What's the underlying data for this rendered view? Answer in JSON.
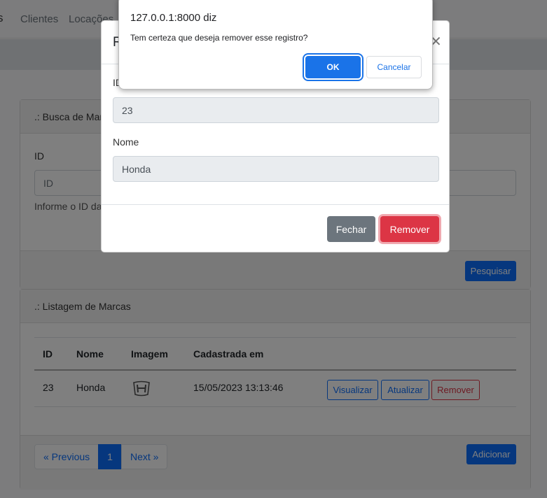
{
  "navbar": {
    "brand": "s",
    "links": [
      "Clientes",
      "Locações"
    ]
  },
  "search_card": {
    "header": ".: Busca de Marcas",
    "id_label": "ID",
    "id_placeholder": "ID",
    "help_text": "Informe o ID da marca",
    "search_button": "Pesquisar"
  },
  "list_card": {
    "header": ".: Listagem de Marcas",
    "columns": [
      "ID",
      "Nome",
      "Imagem",
      "Cadastrada em"
    ],
    "rows": [
      {
        "id": "23",
        "nome": "Honda",
        "imagem_icon": "honda-logo-icon",
        "cadastrada_em": "15/05/2023 13:13:46",
        "actions": [
          "Visualizar",
          "Atualizar",
          "Remover"
        ]
      }
    ],
    "pagination": {
      "previous": "« Previous",
      "current": "1",
      "next": "Next »"
    },
    "add_button": "Adicionar"
  },
  "modal": {
    "title": "R",
    "close_icon": "close-icon",
    "id_label": "ID",
    "id_value": "23",
    "nome_label": "Nome",
    "nome_value": "Honda",
    "close_button": "Fechar",
    "remove_button": "Remover"
  },
  "confirm_dialog": {
    "title": "127.0.0.1:8000 diz",
    "message": "Tem certeza que deseja remover esse registro?",
    "ok": "OK",
    "cancel": "Cancelar"
  },
  "colors": {
    "primary": "#0d6efd",
    "danger": "#dc3545",
    "secondary": "#6c757d",
    "dialog_blue": "#1a73e8"
  }
}
